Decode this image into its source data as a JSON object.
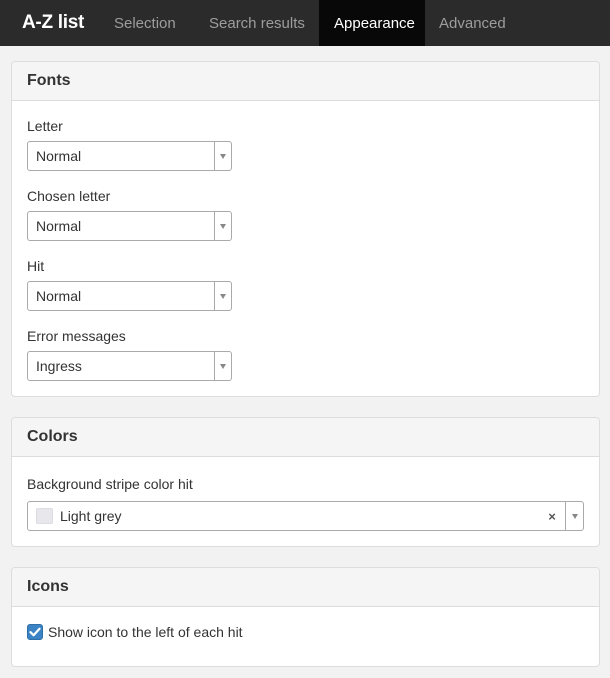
{
  "navbar": {
    "brand": "A-Z list",
    "tabs": [
      {
        "label": "Selection"
      },
      {
        "label": "Search results"
      },
      {
        "label": "Appearance"
      },
      {
        "label": "Advanced"
      }
    ],
    "active_tab": "Appearance"
  },
  "fonts_panel": {
    "title": "Fonts",
    "fields": [
      {
        "label": "Letter",
        "value": "Normal"
      },
      {
        "label": "Chosen letter",
        "value": "Normal"
      },
      {
        "label": "Hit",
        "value": "Normal"
      },
      {
        "label": "Error messages",
        "value": "Ingress"
      }
    ]
  },
  "colors_panel": {
    "title": "Colors",
    "field_label": "Background stripe color hit",
    "value": "Light grey",
    "swatch_color": "#e8e8ec",
    "clear_symbol": "×"
  },
  "icons_panel": {
    "title": "Icons",
    "checkbox_label": "Show icon to the left of each hit",
    "checked": true
  },
  "colors": {
    "navbar_bg": "#2b2b2b",
    "active_tab_bg": "#080808",
    "checkbox_blue": "#3b83c4"
  }
}
